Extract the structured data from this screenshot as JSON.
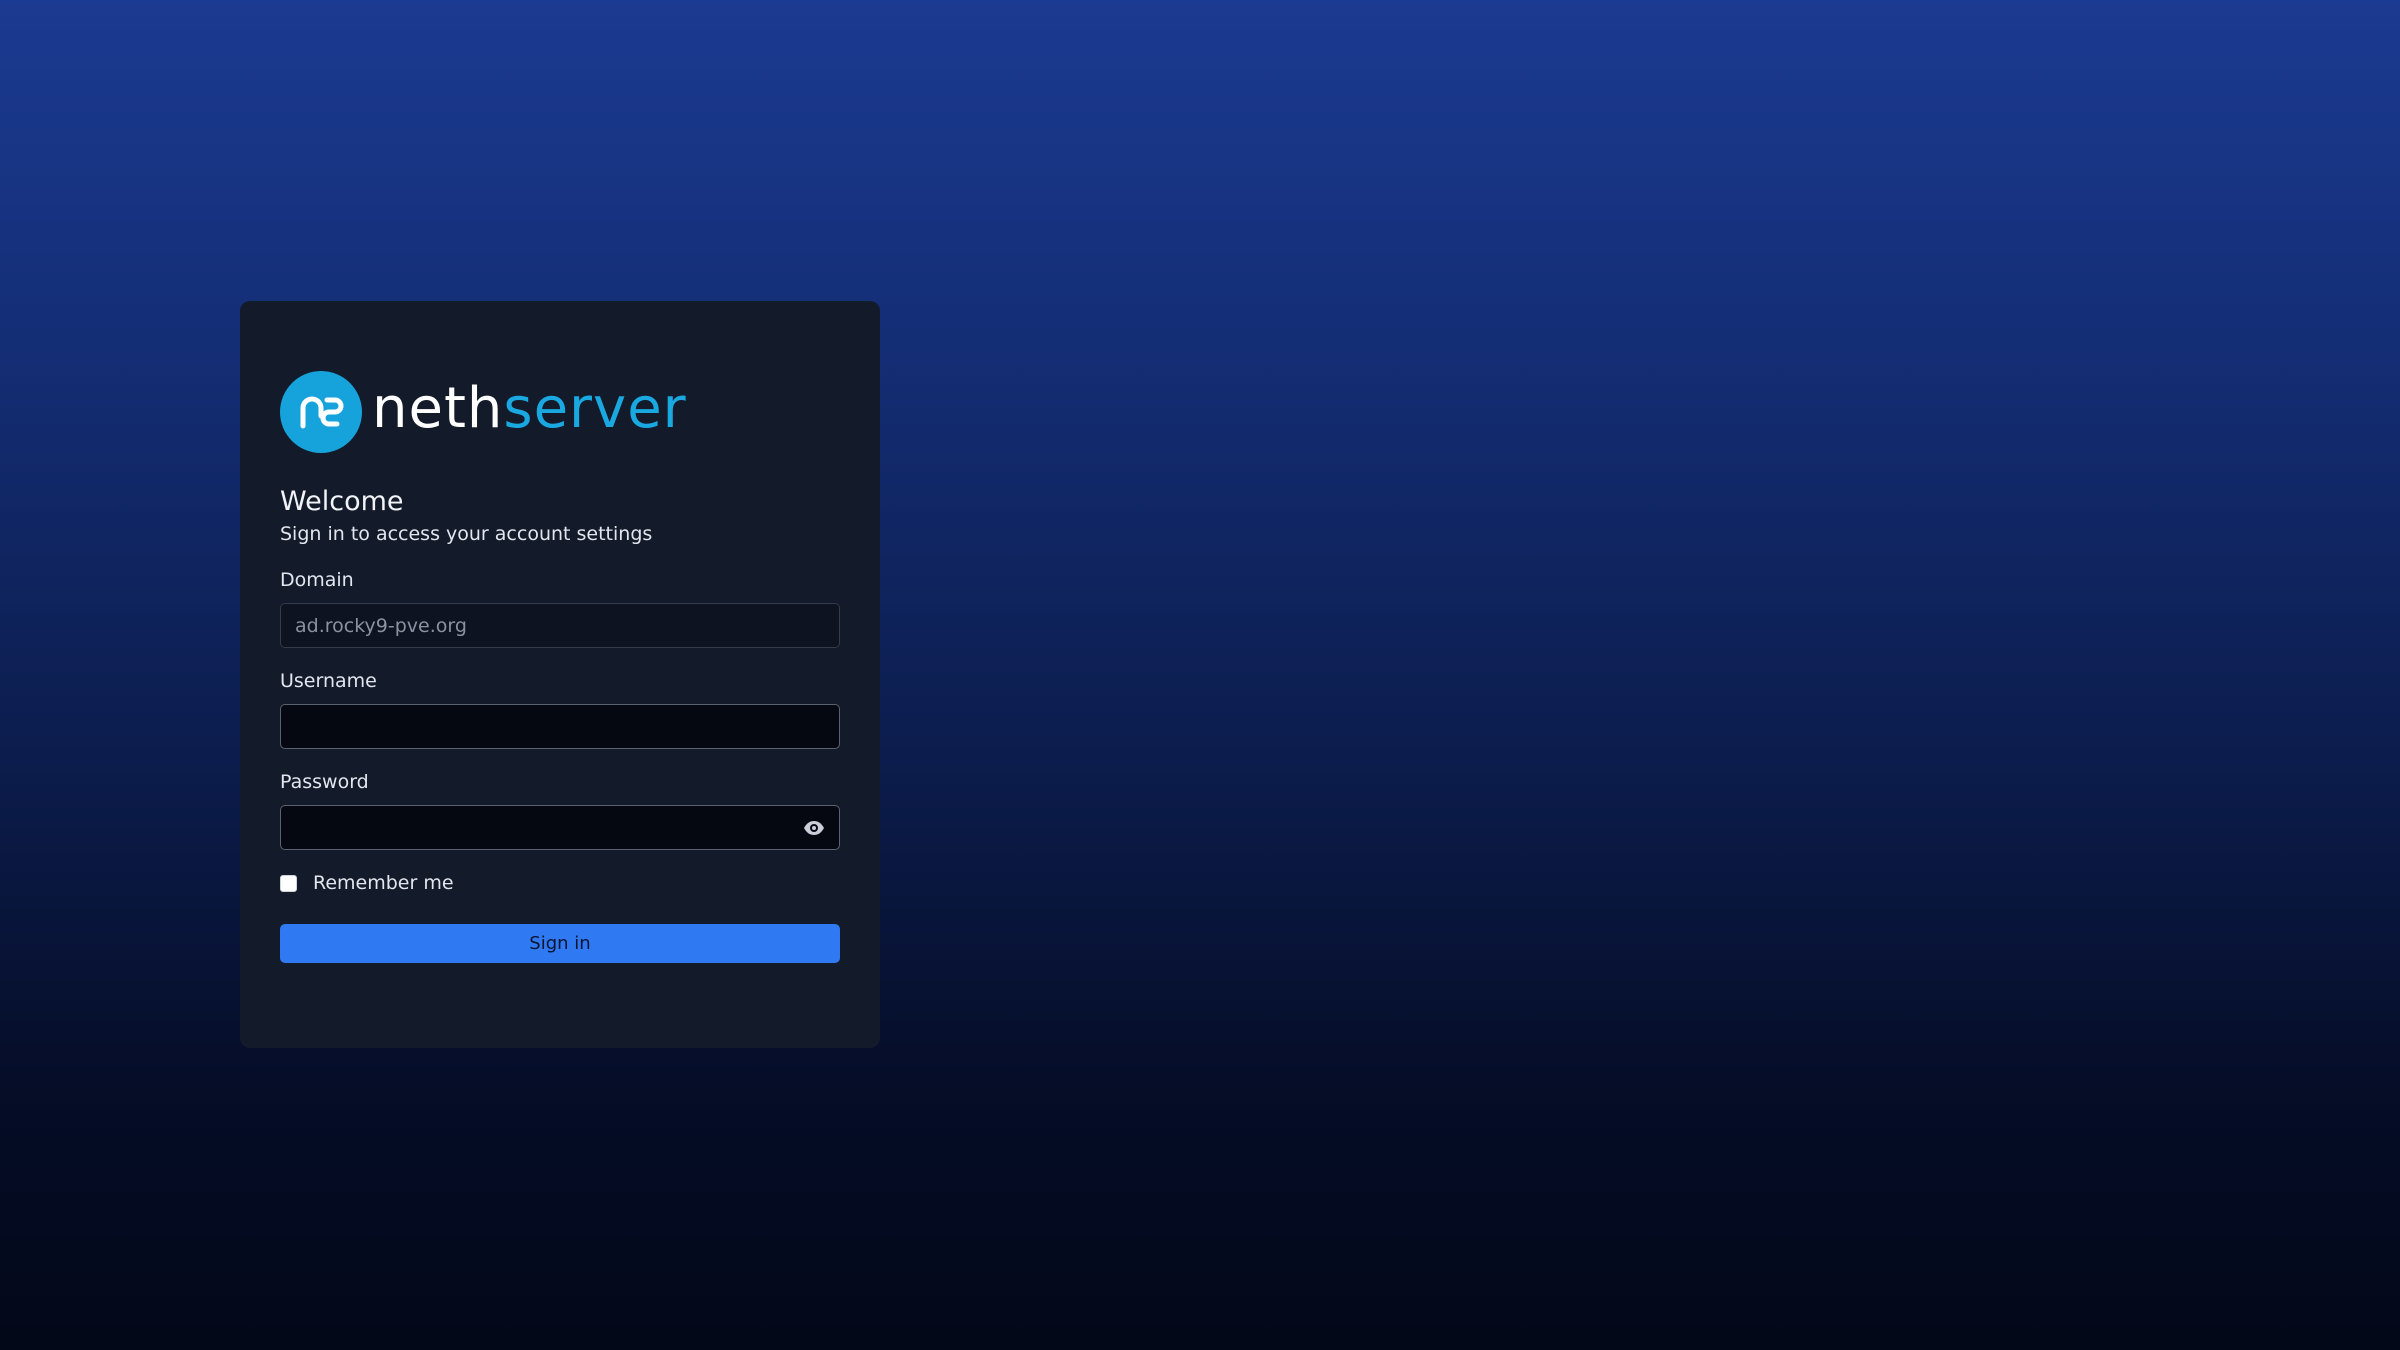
{
  "brand": {
    "name_part1": "neth",
    "name_part2": "server",
    "logo_icon": "nethserver-logo-icon",
    "primary_color": "#16a3dc"
  },
  "login": {
    "title": "Welcome",
    "subtitle": "Sign in to access your account settings",
    "domain": {
      "label": "Domain",
      "placeholder": "ad.rocky9-pve.org",
      "value": ""
    },
    "username": {
      "label": "Username",
      "value": ""
    },
    "password": {
      "label": "Password",
      "value": "",
      "toggle_icon": "eye-icon"
    },
    "remember_me": {
      "label": "Remember me",
      "checked": false
    },
    "submit_label": "Sign in",
    "submit_color": "#2f7af3"
  }
}
